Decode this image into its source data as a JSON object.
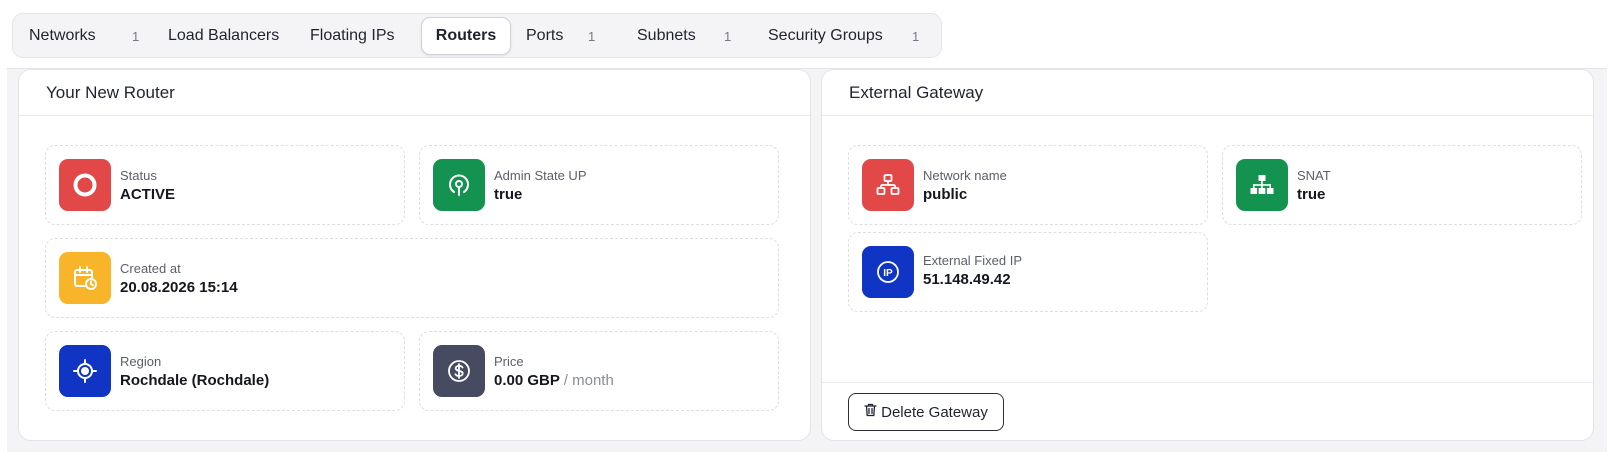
{
  "tabs": [
    {
      "label": "Networks",
      "count": "1"
    },
    {
      "label": "Load Balancers"
    },
    {
      "label": "Floating IPs"
    },
    {
      "label": "Routers",
      "active": true
    },
    {
      "label": "Ports",
      "count": "1"
    },
    {
      "label": "Subnets",
      "count": "1"
    },
    {
      "label": "Security Groups",
      "count": "1"
    }
  ],
  "router": {
    "title": "Your New Router",
    "status": {
      "label": "Status",
      "value": "ACTIVE",
      "icon": "circle-ring-icon",
      "color": "#e24848"
    },
    "admin_state": {
      "label": "Admin State UP",
      "value": "true",
      "icon": "power-icon",
      "color": "#149350"
    },
    "created": {
      "label": "Created at",
      "value": "20.08.2026 15:14",
      "icon": "calendar-clock-icon",
      "color": "#f9b52a"
    },
    "region": {
      "label": "Region",
      "value": "Rochdale (Rochdale)",
      "icon": "location-target-icon",
      "color": "#1034c4"
    },
    "price": {
      "label": "Price",
      "value": "0.00 GBP",
      "unit": "/ month",
      "icon": "dollar-circle-icon",
      "color": "#474b62"
    }
  },
  "gateway": {
    "title": "External Gateway",
    "network": {
      "label": "Network name",
      "value": "public",
      "icon": "network-icon",
      "color": "#e24848"
    },
    "snat": {
      "label": "SNAT",
      "value": "true",
      "icon": "hierarchy-icon",
      "color": "#149350"
    },
    "fixed_ip": {
      "label": "External Fixed IP",
      "value": "51.148.49.42",
      "icon": "ip-icon",
      "color": "#1034c4"
    },
    "delete_label": "Delete Gateway"
  }
}
